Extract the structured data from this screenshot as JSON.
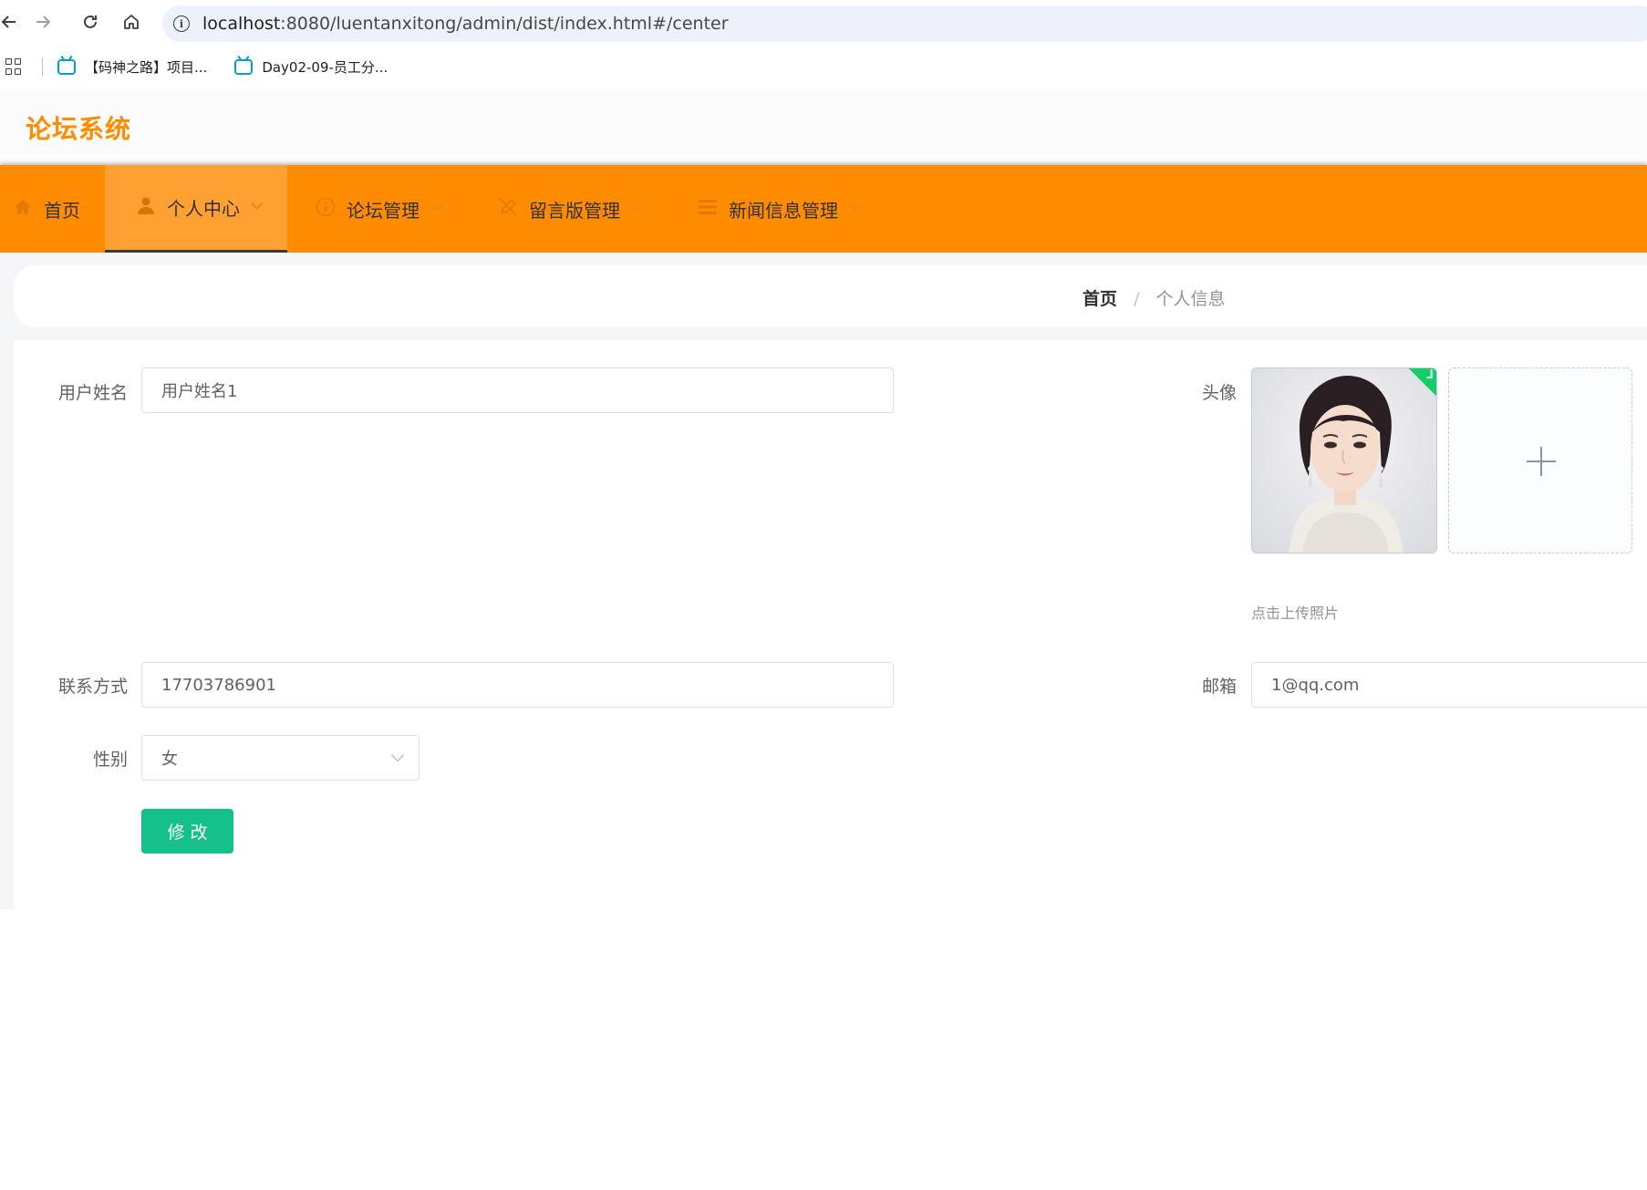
{
  "browser": {
    "url_host": "localhost",
    "url_rest": ":8080/luentanxitong/admin/dist/index.html#/center",
    "bookmarks": [
      {
        "label": "【码神之路】项目..."
      },
      {
        "label": "Day02-09-员工分..."
      }
    ]
  },
  "app": {
    "title": "论坛系统",
    "accent_color": "#ff8c00"
  },
  "nav": {
    "items": [
      {
        "label": "首页",
        "icon": "home-icon",
        "has_dropdown": false,
        "active": false
      },
      {
        "label": "个人中心",
        "icon": "user-icon",
        "has_dropdown": true,
        "active": true
      },
      {
        "label": "论坛管理",
        "icon": "info-icon",
        "has_dropdown": true,
        "active": false
      },
      {
        "label": "留言版管理",
        "icon": "edit-off-icon",
        "has_dropdown": true,
        "active": false
      },
      {
        "label": "新闻信息管理",
        "icon": "list-icon",
        "has_dropdown": true,
        "active": false
      }
    ]
  },
  "breadcrumb": {
    "home": "首页",
    "separator": "/",
    "current": "个人信息"
  },
  "form": {
    "username": {
      "label": "用户姓名",
      "value": "用户姓名1"
    },
    "avatar": {
      "label": "头像",
      "upload_tip": "点击上传照片"
    },
    "phone": {
      "label": "联系方式",
      "value": "17703786901"
    },
    "email": {
      "label": "邮箱",
      "value": "1@qq.com"
    },
    "gender": {
      "label": "性别",
      "value": "女"
    },
    "submit_label": "修改"
  }
}
